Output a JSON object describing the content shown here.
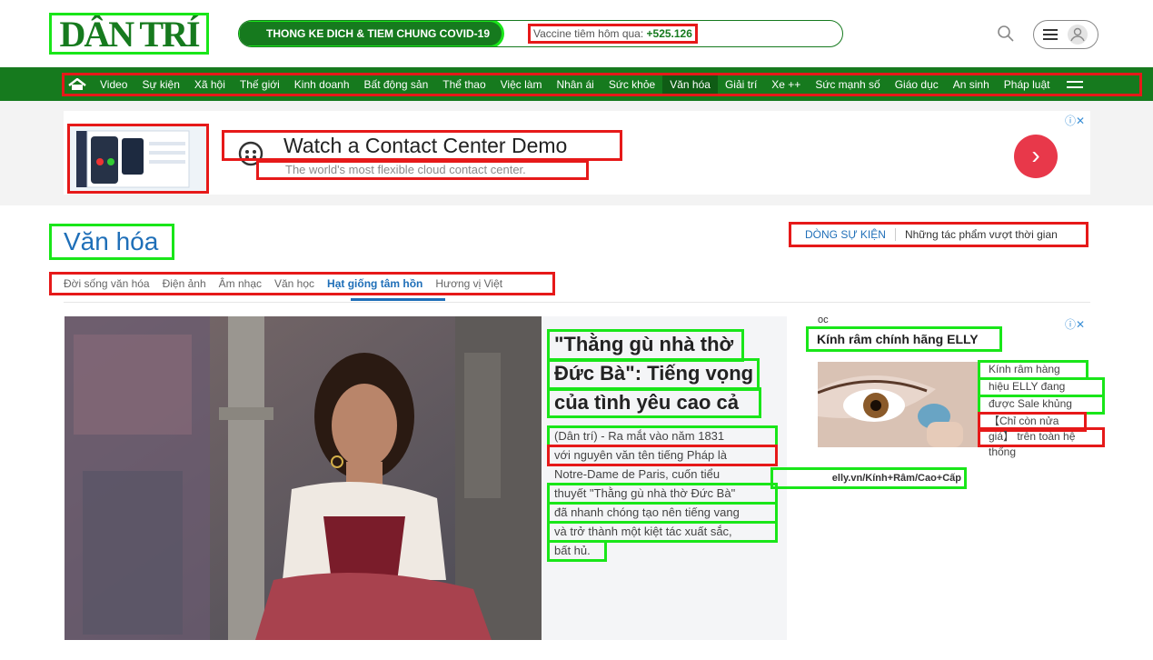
{
  "header": {
    "logo": "DÂN TRÍ",
    "covid_banner": "THONG KE DICH & TIEM CHUNG COVID-19",
    "vaccine_label": "Vaccine tiêm hôm qua:",
    "vaccine_value": "+525.126",
    "brand_color": "#167a1e"
  },
  "nav": {
    "items": [
      "Video",
      "Sự kiện",
      "Xã hội",
      "Thế giới",
      "Kinh doanh",
      "Bất động sản",
      "Thể thao",
      "Việc làm",
      "Nhân ái",
      "Sức khỏe",
      "Văn hóa",
      "Giải trí",
      "Xe ++",
      "Sức mạnh số",
      "Giáo dục",
      "An sinh",
      "Pháp luật"
    ],
    "active": "Văn hóa"
  },
  "ad": {
    "title": "Watch a Contact Center Demo",
    "subtitle": "The world's most flexible cloud contact center.",
    "arrow": "›",
    "adchoices": "ⓘ✕"
  },
  "section": {
    "title": "Văn hóa",
    "event_label": "DÒNG SỰ KIỆN",
    "event_text": "Những tác phẩm vượt thời gian",
    "subnav": [
      "Đời sống văn hóa",
      "Điện ảnh",
      "Âm nhạc",
      "Văn học",
      "Hạt giống tâm hồn",
      "Hương vị Việt"
    ],
    "subnav_active": "Hạt giống tâm hồn"
  },
  "article": {
    "title_lines": [
      "\"Thằng gù nhà thờ",
      "Đức Bà\": Tiếng vọng",
      "của tình yêu cao cả"
    ],
    "sapo_lines": [
      "(Dân trí) - Ra mắt vào năm 1831",
      "với nguyên văn tên tiếng Pháp là",
      "Notre-Dame de Paris, cuốn tiểu",
      "thuyết \"Thằng gù nhà thờ Đức Bà\"",
      "đã nhanh chóng tạo nên tiếng vang",
      "và trở thành một kiệt tác xuất sắc,",
      "bất hủ."
    ]
  },
  "side_ad": {
    "source": "oc",
    "title": "Kính râm chính hãng ELLY",
    "lines": [
      "Kính râm hàng",
      "hiệu ELLY đang",
      "được Sale khủng",
      "【Chỉ còn nửa",
      "giá】 trên toàn hệ",
      "thống"
    ],
    "url": "elly.vn/Kính+Râm/Cao+Cấp",
    "adchoices": "ⓘ✕"
  }
}
